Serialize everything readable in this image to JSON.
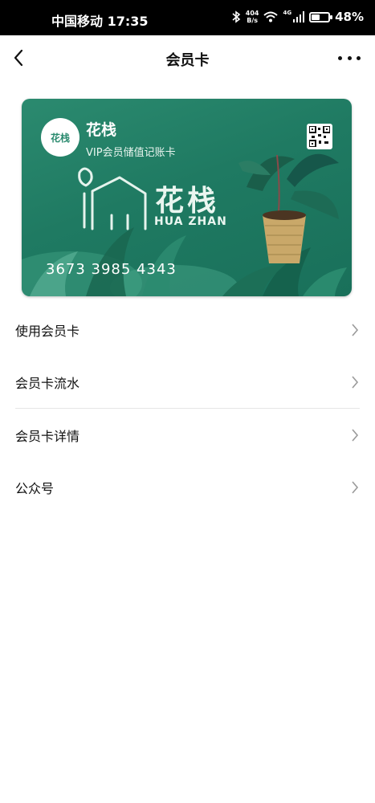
{
  "status_bar": {
    "carrier_time": "中国移动 17:35",
    "net_speed_value": "404",
    "net_speed_unit": "B/s",
    "network_type": "4G",
    "battery": "48%",
    "battery_level": 0.48
  },
  "nav": {
    "title": "会员卡"
  },
  "card": {
    "logo_text": "花栈",
    "shop_name": "花栈",
    "card_type": "VIP会员储值记账卡",
    "watermark_title": "花栈",
    "watermark_subtitle": "HUA ZHAN",
    "card_number": "3673 3985 4343",
    "colors": {
      "primary": "#1f7a62",
      "accent": "#2b8a6f"
    }
  },
  "menu": [
    {
      "label": "使用会员卡",
      "icon": "chevron-right-icon"
    },
    {
      "label": "会员卡流水",
      "icon": "chevron-right-icon"
    },
    {
      "label": "会员卡详情",
      "icon": "chevron-right-icon"
    },
    {
      "label": "公众号",
      "icon": "chevron-right-icon"
    }
  ]
}
